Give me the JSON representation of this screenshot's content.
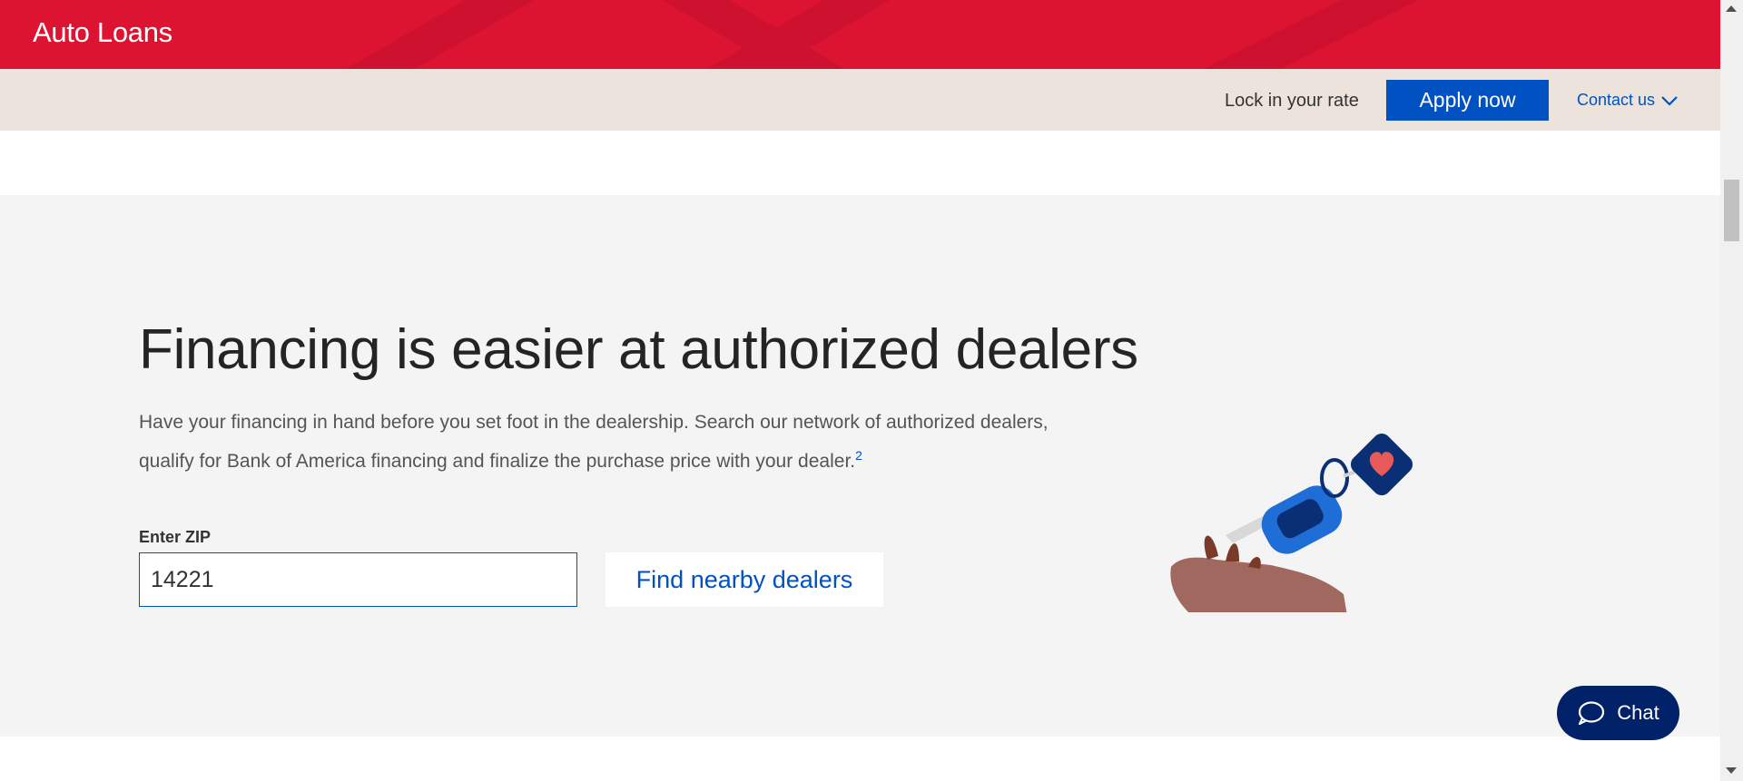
{
  "header": {
    "title": "Auto Loans"
  },
  "action_bar": {
    "lock_text": "Lock in your rate",
    "apply_label": "Apply now",
    "contact_label": "Contact us"
  },
  "hero": {
    "heading": "Financing is easier at authorized dealers",
    "description": "Have your financing in hand before you set foot in the dealership. Search our network of authorized dealers, qualify for Bank of America financing and finalize the purchase price with your dealer.",
    "footnote": "2",
    "zip_label": "Enter ZIP",
    "zip_value": "14221",
    "find_label": "Find nearby dealers"
  },
  "chat": {
    "label": "Chat"
  },
  "colors": {
    "brand_red": "#dc1431",
    "brand_blue": "#0052c2",
    "navy": "#012169",
    "beige": "#ece4dc",
    "hero_bg": "#f4f4f4"
  }
}
